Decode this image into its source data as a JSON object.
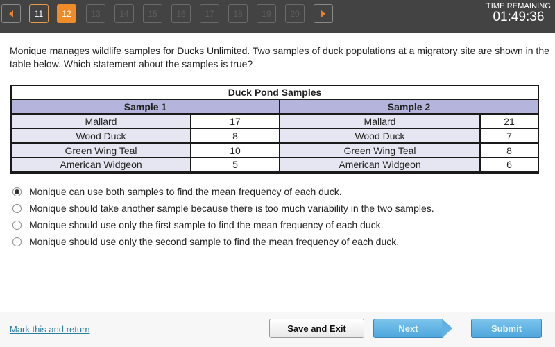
{
  "nav": {
    "prev_icon": "chevron-left-icon",
    "next_icon": "chevron-right-icon",
    "questions": [
      {
        "label": "11",
        "state": "visited"
      },
      {
        "label": "12",
        "state": "current"
      },
      {
        "label": "13",
        "state": "disabled"
      },
      {
        "label": "14",
        "state": "disabled"
      },
      {
        "label": "15",
        "state": "disabled"
      },
      {
        "label": "16",
        "state": "disabled"
      },
      {
        "label": "17",
        "state": "disabled"
      },
      {
        "label": "18",
        "state": "disabled"
      },
      {
        "label": "19",
        "state": "disabled"
      },
      {
        "label": "20",
        "state": "disabled"
      }
    ]
  },
  "timer": {
    "label": "TIME REMAINING",
    "value": "01:49:36"
  },
  "question": {
    "text": "Monique manages wildlife samples for Ducks Unlimited. Two samples of duck populations at a migratory site are shown in the table below. Which statement about the samples is true?"
  },
  "table": {
    "title": "Duck Pond Samples",
    "sample1_header": "Sample 1",
    "sample2_header": "Sample 2",
    "rows": [
      {
        "s1_name": "Mallard",
        "s1_value": "17",
        "s2_name": "Mallard",
        "s2_value": "21"
      },
      {
        "s1_name": "Wood Duck",
        "s1_value": "8",
        "s2_name": "Wood Duck",
        "s2_value": "7"
      },
      {
        "s1_name": "Green Wing Teal",
        "s1_value": "10",
        "s2_name": "Green Wing Teal",
        "s2_value": "8"
      },
      {
        "s1_name": "American Widgeon",
        "s1_value": "5",
        "s2_name": "American Widgeon",
        "s2_value": "6"
      }
    ]
  },
  "options": [
    {
      "text": "Monique can use both samples to find the mean frequency of each duck.",
      "selected": true
    },
    {
      "text": "Monique should take another sample because there is too much variability in the two samples.",
      "selected": false
    },
    {
      "text": "Monique should use only the first sample to find the mean frequency of each duck.",
      "selected": false
    },
    {
      "text": "Monique should use only the second sample to find the mean frequency of each duck.",
      "selected": false
    }
  ],
  "footer": {
    "mark_label": "Mark this and return",
    "save_label": "Save and Exit",
    "next_label": "Next",
    "submit_label": "Submit"
  },
  "colors": {
    "topbar": "#434343",
    "accent_orange": "#f08c28",
    "table_header": "#b4b4dc",
    "table_name_cell": "#e6e6f2",
    "button_blue": "#5fb2e2",
    "link": "#2a7fa0"
  }
}
